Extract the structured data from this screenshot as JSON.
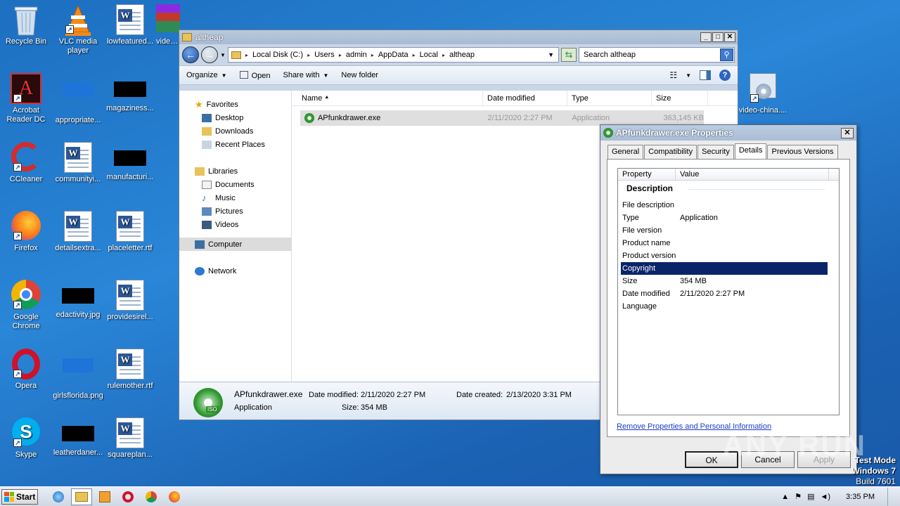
{
  "desktop": {
    "icons": [
      {
        "label": "Recycle Bin"
      },
      {
        "label": "VLC media player"
      },
      {
        "label": "lowfeatured..."
      },
      {
        "label": "video..."
      },
      {
        "label": "Acrobat Reader DC"
      },
      {
        "label": "appropriate..."
      },
      {
        "label": "magaziness..."
      },
      {
        "label": "CCleaner"
      },
      {
        "label": "communityi..."
      },
      {
        "label": "manufacturi..."
      },
      {
        "label": "Firefox"
      },
      {
        "label": "detailsextra..."
      },
      {
        "label": "placeletter.rtf"
      },
      {
        "label": "Google Chrome"
      },
      {
        "label": "edactivity.jpg"
      },
      {
        "label": "providesirel..."
      },
      {
        "label": "Opera"
      },
      {
        "label": "girlsflorida.png"
      },
      {
        "label": "rulemother.rtf"
      },
      {
        "label": "Skype"
      },
      {
        "label": "leatherdaner..."
      },
      {
        "label": "squareplan..."
      },
      {
        "label": "video-china...."
      }
    ]
  },
  "explorer": {
    "title": "altheap",
    "breadcrumb": [
      "Local Disk (C:)",
      "Users",
      "admin",
      "AppData",
      "Local",
      "altheap"
    ],
    "search_placeholder": "Search altheap",
    "toolbar": {
      "organize": "Organize",
      "open": "Open",
      "share": "Share with",
      "new_folder": "New folder"
    },
    "nav": {
      "favorites": "Favorites",
      "desktop": "Desktop",
      "downloads": "Downloads",
      "recent": "Recent Places",
      "libraries": "Libraries",
      "documents": "Documents",
      "music": "Music",
      "pictures": "Pictures",
      "videos": "Videos",
      "computer": "Computer",
      "network": "Network"
    },
    "columns": {
      "name": "Name",
      "date": "Date modified",
      "type": "Type",
      "size": "Size"
    },
    "file": {
      "name": "APfunkdrawer.exe",
      "date": "2/11/2020 2:27 PM",
      "type": "Application",
      "size": "363,145 KB"
    },
    "details": {
      "name": "APfunkdrawer.exe",
      "type": "Application",
      "date_modified_label": "Date modified:",
      "date_modified": "2/11/2020 2:27 PM",
      "date_created_label": "Date created:",
      "date_created": "2/13/2020 3:31 PM",
      "size_label": "Size:",
      "size": "354 MB",
      "iso_label": "ISO"
    }
  },
  "properties": {
    "title": "APfunkdrawer.exe Properties",
    "tabs": [
      "General",
      "Compatibility",
      "Security",
      "Details",
      "Previous Versions"
    ],
    "col_property": "Property",
    "col_value": "Value",
    "section": "Description",
    "rows": [
      {
        "k": "File description",
        "v": ""
      },
      {
        "k": "Type",
        "v": "Application"
      },
      {
        "k": "File version",
        "v": ""
      },
      {
        "k": "Product name",
        "v": ""
      },
      {
        "k": "Product version",
        "v": ""
      },
      {
        "k": "Copyright",
        "v": ""
      },
      {
        "k": "Size",
        "v": "354 MB"
      },
      {
        "k": "Date modified",
        "v": "2/11/2020 2:27 PM"
      },
      {
        "k": "Language",
        "v": ""
      }
    ],
    "link": "Remove Properties and Personal Information",
    "ok": "OK",
    "cancel": "Cancel",
    "apply": "Apply"
  },
  "taskbar": {
    "start": "Start",
    "clock": "3:35 PM"
  },
  "watermark": "ANY RUN",
  "testmode": {
    "line1": "Test Mode",
    "line2": "Windows 7",
    "line3": "Build 7601"
  }
}
